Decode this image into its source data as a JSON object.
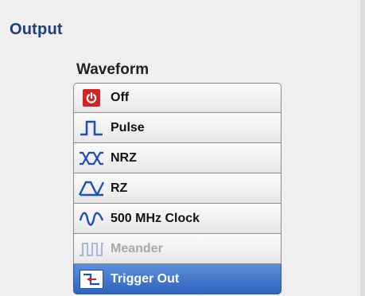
{
  "panel": {
    "title": "Output",
    "waveform_label": "Waveform"
  },
  "waveforms": [
    {
      "label": "Off",
      "icon": "power-icon",
      "state": "normal"
    },
    {
      "label": "Pulse",
      "icon": "pulse-wave-icon",
      "state": "normal"
    },
    {
      "label": "NRZ",
      "icon": "nrz-wave-icon",
      "state": "normal"
    },
    {
      "label": "RZ",
      "icon": "rz-wave-icon",
      "state": "normal"
    },
    {
      "label": "500 MHz Clock",
      "icon": "sine-wave-icon",
      "state": "normal"
    },
    {
      "label": "Meander",
      "icon": "meander-wave-icon",
      "state": "disabled"
    },
    {
      "label": "Trigger Out",
      "icon": "trigger-out-icon",
      "state": "selected"
    }
  ],
  "colors": {
    "title": "#1f3f7a",
    "icon_blue": "#1d4fb4",
    "power_red": "#d62222",
    "selected_top": "#5c8fd8",
    "selected_bottom": "#2f63c0",
    "disabled_text": "#a9a9a9"
  }
}
